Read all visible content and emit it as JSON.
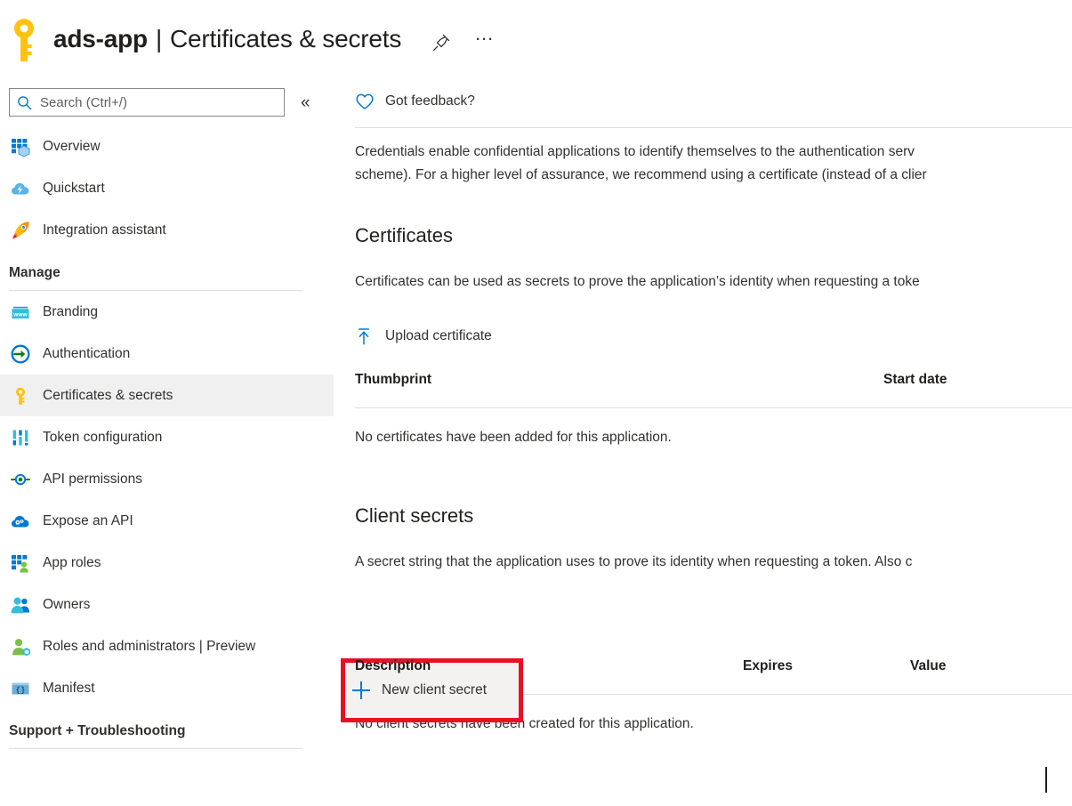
{
  "header": {
    "resource_name": "ads-app",
    "separator": "|",
    "blade_title": "Certificates & secrets",
    "pin_icon": "pin-icon",
    "more_icon": "…",
    "key_icon": "key-icon"
  },
  "sidebar": {
    "search": {
      "placeholder": "Search (Ctrl+/)",
      "value": "",
      "icon": "search-icon"
    },
    "collapse_label": "«",
    "top_items": [
      {
        "label": "Overview",
        "icon": "overview-grid-icon",
        "selected": false
      },
      {
        "label": "Quickstart",
        "icon": "cloud-lightning-icon",
        "selected": false
      },
      {
        "label": "Integration assistant",
        "icon": "rocket-icon",
        "selected": false
      }
    ],
    "groups": [
      {
        "title": "Manage",
        "items": [
          {
            "label": "Branding",
            "icon": "browser-www-icon",
            "selected": false
          },
          {
            "label": "Authentication",
            "icon": "authentication-arrow-icon",
            "selected": false
          },
          {
            "label": "Certificates & secrets",
            "icon": "key-icon",
            "selected": true
          },
          {
            "label": "Token configuration",
            "icon": "token-bars-icon",
            "selected": false
          },
          {
            "label": "API permissions",
            "icon": "api-permissions-icon",
            "selected": false
          },
          {
            "label": "Expose an API",
            "icon": "cloud-gear-icon",
            "selected": false
          },
          {
            "label": "App roles",
            "icon": "app-roles-icon",
            "selected": false
          },
          {
            "label": "Owners",
            "icon": "owners-people-icon",
            "selected": false
          },
          {
            "label": "Roles and administrators | Preview",
            "icon": "roles-admin-icon",
            "selected": false
          },
          {
            "label": "Manifest",
            "icon": "manifest-braces-icon",
            "selected": false
          }
        ]
      },
      {
        "title": "Support + Troubleshooting",
        "items": []
      }
    ]
  },
  "main": {
    "feedback": {
      "label": "Got feedback?",
      "icon": "heart-icon"
    },
    "intro_line1": "Credentials enable confidential applications to identify themselves to the authentication serv",
    "intro_line2": "scheme). For a higher level of assurance, we recommend using a certificate (instead of a clier",
    "certificates": {
      "heading": "Certificates",
      "description": "Certificates can be used as secrets to prove the application’s identity when requesting a toke",
      "upload_button": {
        "label": "Upload certificate",
        "icon": "upload-icon"
      },
      "columns": [
        "Thumbprint",
        "Start date"
      ],
      "empty_message": "No certificates have been added for this application."
    },
    "client_secrets": {
      "heading": "Client secrets",
      "description": "A secret string that the application uses to prove its identity when requesting a token. Also c",
      "new_button": {
        "label": "New client secret",
        "icon": "plus-icon"
      },
      "columns": [
        "Description",
        "Expires",
        "Value"
      ],
      "empty_message": "No client secrets have been created for this application."
    }
  },
  "annotation": {
    "color": "#e81123",
    "target": "new-client-secret-button"
  }
}
